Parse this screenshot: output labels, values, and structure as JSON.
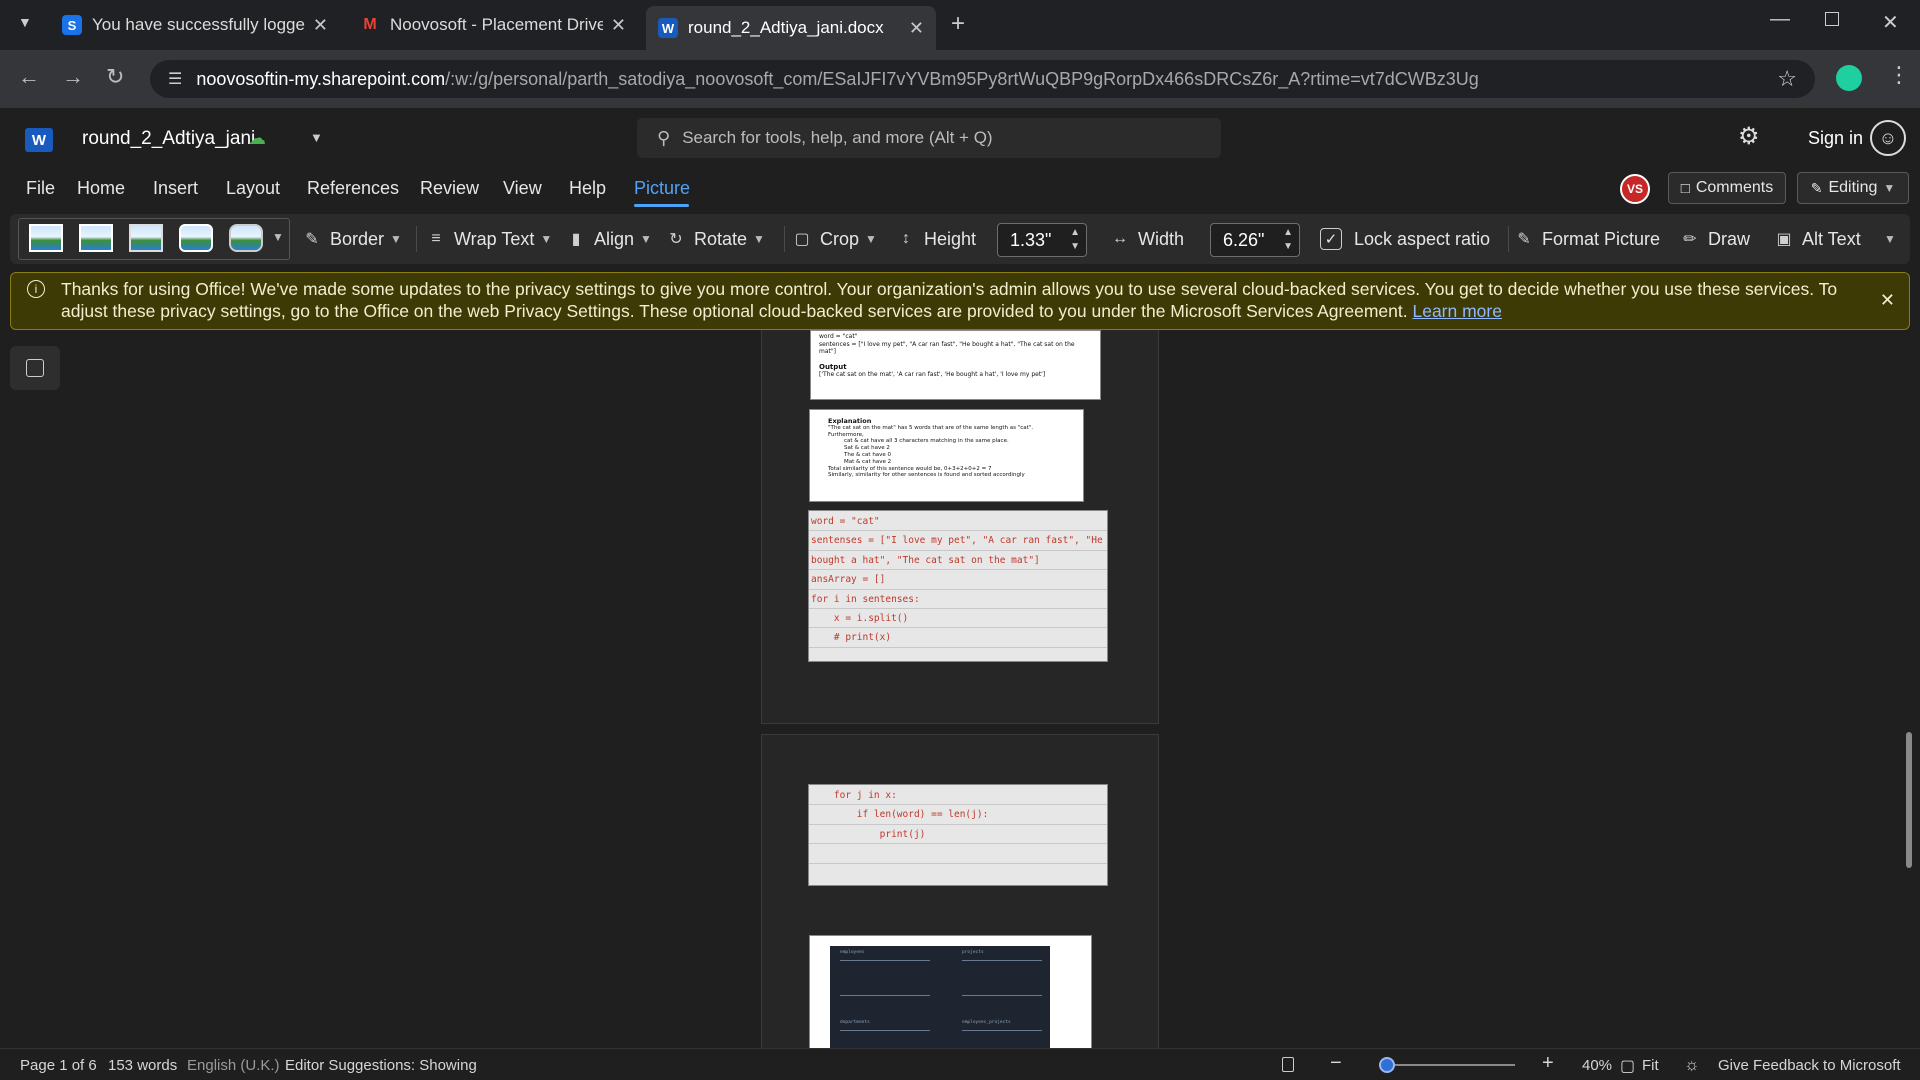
{
  "browser": {
    "tabs": [
      {
        "title": "You have successfully logged o",
        "favicon": "S",
        "favicon_color": "#1a73e8"
      },
      {
        "title": "Noovosoft - Placement Drive - ",
        "favicon": "M",
        "favicon_color": "#ea4335"
      },
      {
        "title": "round_2_Adtiya_jani.docx",
        "favicon": "W",
        "favicon_color": "#185abd"
      }
    ],
    "url_host": "noovosoftin-my.sharepoint.com",
    "url_path": "/:w:/g/personal/parth_satodiya_noovosoft_com/ESaIJFI7vYVBm95Py8rtWuQBP9gRorpDx466sDRCsZ6r_A?rtime=vt7dCWBz3Ug"
  },
  "word": {
    "doc_name": "round_2_Adtiya_jani",
    "search_placeholder": "Search for tools, help, and more (Alt + Q)",
    "sign_in": "Sign in",
    "avatar_initials": "VS",
    "comments_label": "Comments",
    "editing_label": "Editing"
  },
  "menu": [
    "File",
    "Home",
    "Insert",
    "Layout",
    "References",
    "Review",
    "View",
    "Help",
    "Picture"
  ],
  "ribbon": {
    "border": "Border",
    "wrap_text": "Wrap Text",
    "align": "Align",
    "rotate": "Rotate",
    "crop": "Crop",
    "height_label": "Height",
    "height_value": "1.33\"",
    "width_label": "Width",
    "width_value": "6.26\"",
    "lock_aspect": "Lock aspect ratio",
    "format_picture": "Format Picture",
    "draw": "Draw",
    "alt_text": "Alt Text"
  },
  "banner": {
    "text": "Thanks for using Office! We've made some updates to the privacy settings to give you more control. Your organization's admin allows you to use several cloud-backed services. You get to decide whether you use these services. To adjust these privacy settings, go to the Office on the web Privacy Settings. These optional cloud-backed services are provided to you under the Microsoft Services Agreement.",
    "link": "Learn more"
  },
  "doc": {
    "img1": {
      "word_line": "word = \"cat\"",
      "sentences_line": "sentences = [\"I love my pet\", \"A car ran fast\", \"He bought a hat\", \"The cat sat on the mat\"]",
      "output_label": "Output",
      "output_line": "['The cat sat on the mat', 'A car ran fast', 'He bought a hat', 'I love my pet']"
    },
    "img2": {
      "title": "Explanation",
      "lines": [
        "\"The cat sat on the mat\" has 5 words that are of the same length as \"cat\".",
        "Furthermore,",
        "cat & cat have all 3 characters matching in the same place.",
        "Sat & cat have 2",
        "The & cat have 0",
        "Mat & cat have 2",
        "Total similarity of this sentence would be, 0+3+2+0+2 = 7",
        "Similarly, similarity for other sentences is found and sorted accordingly"
      ]
    },
    "code1": [
      "word = \"cat\"",
      "sentenses = [\"I love my pet\", \"A car ran fast\", \"He",
      "bought a hat\", \"The cat sat on the mat\"]",
      "ansArray = []",
      "for i in sentenses:",
      "    x = i.split()",
      "    # print(x)"
    ],
    "code2": [
      "    for j in x:",
      "        if len(word) == len(j):",
      "            print(j)"
    ],
    "schema_labels": [
      "employees",
      "projects",
      "departments",
      "employees_projects"
    ]
  },
  "status": {
    "page": "Page 1 of 6",
    "words": "153 words",
    "language": "English (U.K.)",
    "editor": "Editor Suggestions: Showing",
    "zoom": "40%",
    "fit": "Fit",
    "feedback": "Give Feedback to Microsoft",
    "zoom_fraction": 0.05
  }
}
